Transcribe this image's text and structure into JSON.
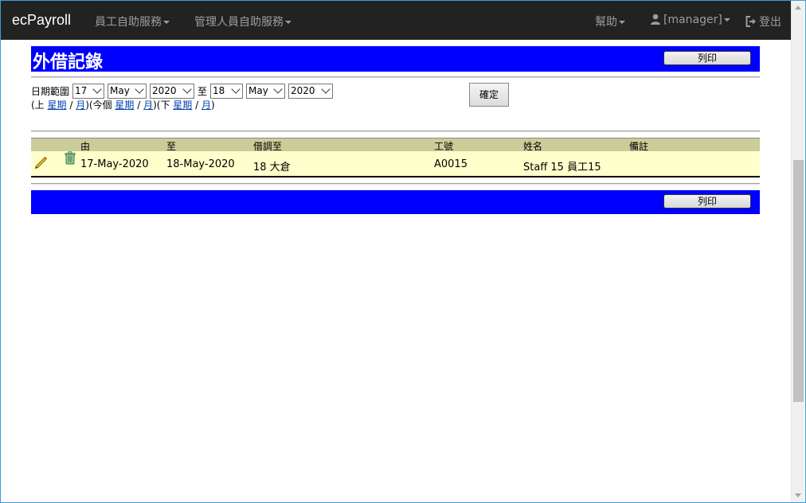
{
  "navbar": {
    "brand": "ecPayroll",
    "menu_employee": "員工自助服務",
    "menu_manager": "管理人員自助服務",
    "menu_help": "幫助",
    "menu_user": "[manager]",
    "menu_logout": "登出"
  },
  "page": {
    "title": "外借記錄",
    "print_label": "列印",
    "confirm_label": "確定"
  },
  "date_range": {
    "label": "日期範圍",
    "separator": "至",
    "from": {
      "day": "17",
      "month": "May",
      "year": "2020"
    },
    "to": {
      "day": "18",
      "month": "May",
      "year": "2020"
    }
  },
  "quick_links": {
    "prev_prefix": "(上 ",
    "this_prefix": ")(今個 ",
    "next_prefix": ")(下 ",
    "week": "星期",
    "slash": " / ",
    "month": "月",
    "close": ")"
  },
  "table": {
    "headers": {
      "from": "由",
      "to": "至",
      "transfer_to": "借調至",
      "employee_no": "工號",
      "name": "姓名",
      "remarks": "備註"
    },
    "rows": [
      {
        "from": "17-May-2020",
        "to": "18-May-2020",
        "transfer_to": "18 大倉",
        "employee_no": "A0015",
        "name": "Staff 15 員工15",
        "remarks": ""
      }
    ]
  },
  "icons": {
    "edit": "pencil-icon",
    "delete": "trash-icon",
    "user": "user-icon",
    "logout": "logout-icon"
  }
}
